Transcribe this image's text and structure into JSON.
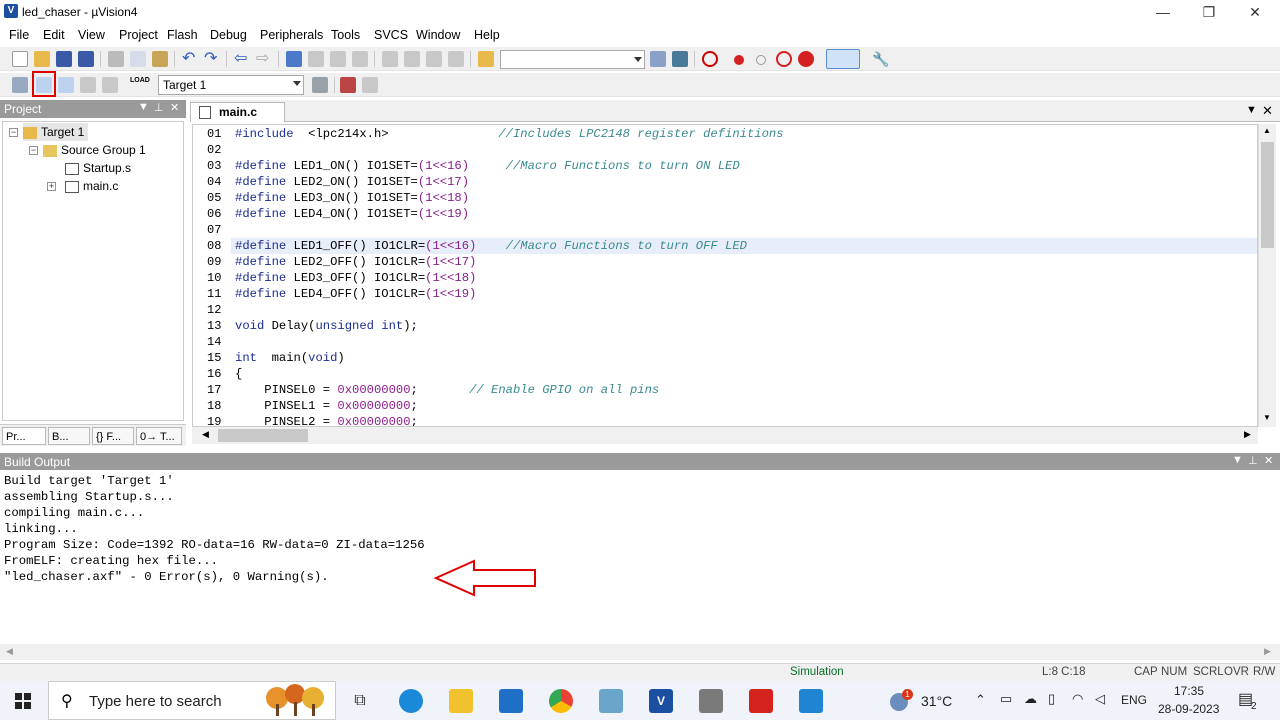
{
  "window": {
    "title": "led_chaser  - µVision4",
    "minimize": "—",
    "restore": "❐",
    "close": "✕"
  },
  "menu": [
    "File",
    "Edit",
    "View",
    "Project",
    "Flash",
    "Debug",
    "Peripherals",
    "Tools",
    "SVCS",
    "Window",
    "Help"
  ],
  "toolbar": {
    "target_select": "Target 1",
    "load_label": "LOAD"
  },
  "project_panel": {
    "title": "Project",
    "tree": {
      "target": "Target 1",
      "group": "Source Group 1",
      "file1": "Startup.s",
      "file2": "main.c"
    },
    "tabs": [
      "Pr...",
      "B...",
      "{} F...",
      "0→ T..."
    ]
  },
  "editor": {
    "tab_label": "main.c",
    "lines": [
      {
        "n": "01",
        "parts": [
          [
            "kw",
            "#include  "
          ],
          [
            "pl",
            "<lpc214x.h>"
          ],
          [
            "pl",
            "               "
          ],
          [
            "cm",
            "//Includes LPC2148 register definitions"
          ]
        ]
      },
      {
        "n": "02",
        "parts": []
      },
      {
        "n": "03",
        "parts": [
          [
            "kw",
            "#define "
          ],
          [
            "pl",
            "LED1_ON() IO1SET="
          ],
          [
            "nm",
            "(1<<16)"
          ],
          [
            "pl",
            "     "
          ],
          [
            "cm",
            "//Macro Functions to turn ON LED"
          ]
        ]
      },
      {
        "n": "04",
        "parts": [
          [
            "kw",
            "#define "
          ],
          [
            "pl",
            "LED2_ON() IO1SET="
          ],
          [
            "nm",
            "(1<<17)"
          ]
        ]
      },
      {
        "n": "05",
        "parts": [
          [
            "kw",
            "#define "
          ],
          [
            "pl",
            "LED3_ON() IO1SET="
          ],
          [
            "nm",
            "(1<<18)"
          ]
        ]
      },
      {
        "n": "06",
        "parts": [
          [
            "kw",
            "#define "
          ],
          [
            "pl",
            "LED4_ON() IO1SET="
          ],
          [
            "nm",
            "(1<<19)"
          ]
        ]
      },
      {
        "n": "07",
        "parts": []
      },
      {
        "n": "08",
        "parts": [
          [
            "kw",
            "#define "
          ],
          [
            "pl",
            "LED1_OFF() IO1CLR="
          ],
          [
            "nm",
            "(1<<16)"
          ],
          [
            "pl",
            "    "
          ],
          [
            "cm",
            "//Macro Functions to turn OFF LED"
          ]
        ]
      },
      {
        "n": "09",
        "parts": [
          [
            "kw",
            "#define "
          ],
          [
            "pl",
            "LED2_OFF() IO1CLR="
          ],
          [
            "nm",
            "(1<<17)"
          ]
        ]
      },
      {
        "n": "10",
        "parts": [
          [
            "kw",
            "#define "
          ],
          [
            "pl",
            "LED3_OFF() IO1CLR="
          ],
          [
            "nm",
            "(1<<18)"
          ]
        ]
      },
      {
        "n": "11",
        "parts": [
          [
            "kw",
            "#define "
          ],
          [
            "pl",
            "LED4_OFF() IO1CLR="
          ],
          [
            "nm",
            "(1<<19)"
          ]
        ]
      },
      {
        "n": "12",
        "parts": []
      },
      {
        "n": "13",
        "parts": [
          [
            "kw",
            "void "
          ],
          [
            "pl",
            "Delay("
          ],
          [
            "kw",
            "unsigned int"
          ],
          [
            "pl",
            ");"
          ]
        ]
      },
      {
        "n": "14",
        "parts": []
      },
      {
        "n": "15",
        "parts": [
          [
            "kw",
            "int  "
          ],
          [
            "pl",
            "main("
          ],
          [
            "kw",
            "void"
          ],
          [
            "pl",
            ")"
          ]
        ]
      },
      {
        "n": "16",
        "parts": [
          [
            "pl",
            "{"
          ]
        ]
      },
      {
        "n": "17",
        "parts": [
          [
            "pl",
            "    PINSEL0 = "
          ],
          [
            "nm",
            "0x00000000"
          ],
          [
            "pl",
            ";       "
          ],
          [
            "cm",
            "// Enable GPIO on all pins"
          ]
        ]
      },
      {
        "n": "18",
        "parts": [
          [
            "pl",
            "    PINSEL1 = "
          ],
          [
            "nm",
            "0x00000000"
          ],
          [
            "pl",
            ";"
          ]
        ]
      },
      {
        "n": "19",
        "parts": [
          [
            "pl",
            "    PINSEL2 = "
          ],
          [
            "nm",
            "0x00000000"
          ],
          [
            "pl",
            ";"
          ]
        ]
      }
    ]
  },
  "build_output": {
    "title": "Build Output",
    "lines": [
      "Build target 'Target 1'",
      "assembling Startup.s...",
      "compiling main.c...",
      "linking...",
      "Program Size: Code=1392 RO-data=16 RW-data=0 ZI-data=1256",
      "FromELF: creating hex file...",
      "\"led_chaser.axf\" - 0 Error(s), 0 Warning(s)."
    ]
  },
  "status": {
    "mode": "Simulation",
    "position": "L:8 C:18",
    "cap": "CAP",
    "num": "NUM",
    "scrl": "SCRL",
    "ovr": "OVR",
    "rw": "R/W"
  },
  "taskbar": {
    "search_placeholder": "Type here to search",
    "weather": "31°C",
    "lang": "ENG",
    "time": "17:35",
    "date": "28-09-2023",
    "notification_count": "2",
    "weather_badge": "1"
  },
  "colors": {
    "keyword": "#1c2d94",
    "comment": "#3a8a8f",
    "number": "#8c1d8c",
    "highlight": "#e00000",
    "panel_header": "#9a9a9a"
  }
}
